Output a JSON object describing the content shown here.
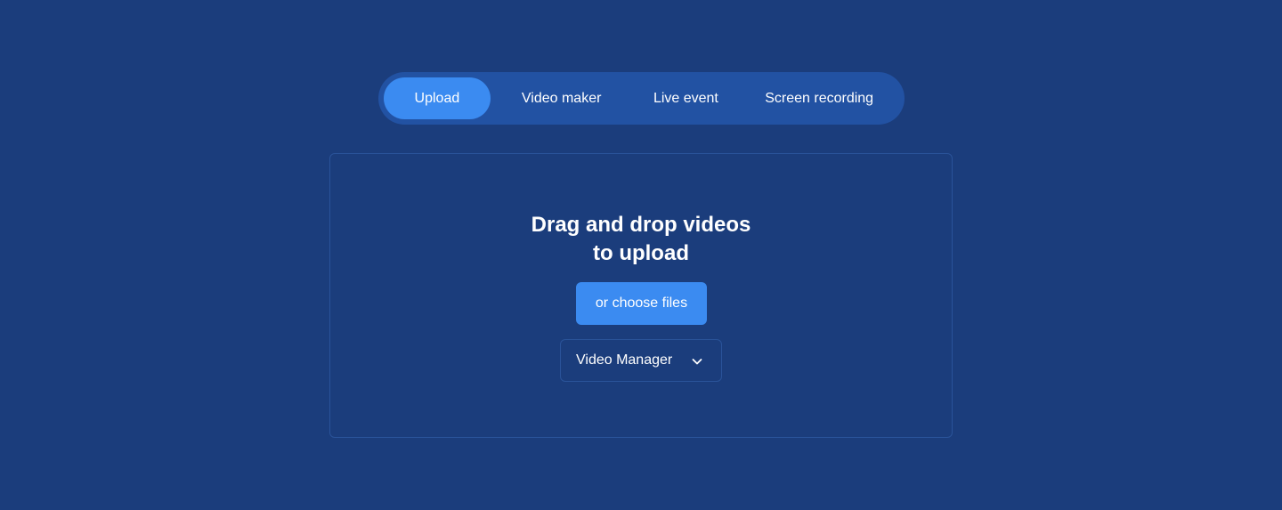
{
  "tabs": [
    {
      "label": "Upload",
      "active": true
    },
    {
      "label": "Video maker",
      "active": false
    },
    {
      "label": "Live event",
      "active": false
    },
    {
      "label": "Screen recording",
      "active": false
    }
  ],
  "dropzone": {
    "heading_line1": "Drag and drop videos",
    "heading_line2": "to upload",
    "choose_button_label": "or choose files",
    "destination_select": {
      "selected": "Video Manager",
      "icon": "chevron-down-icon"
    }
  },
  "colors": {
    "background": "#1b3d7c",
    "tabbar": "#2252a3",
    "accent": "#3b8bf1",
    "border": "#2a5399",
    "text": "#ffffff"
  }
}
